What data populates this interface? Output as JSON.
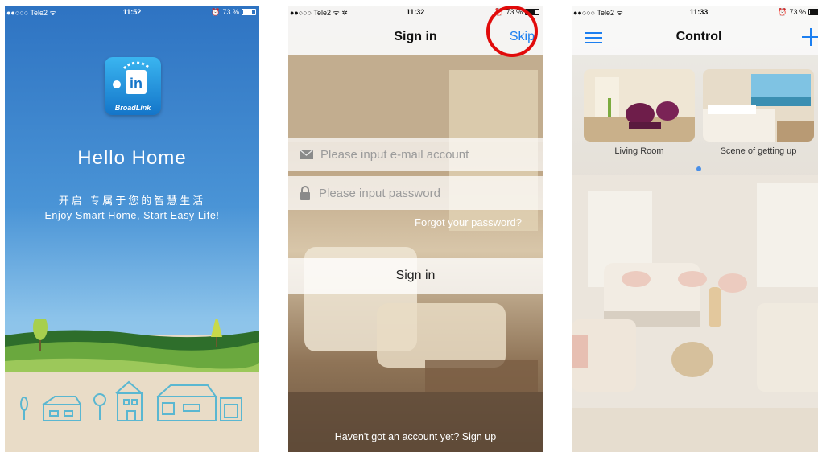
{
  "screen1": {
    "status": {
      "carrier": "●●○○○ Tele2 ᯤ",
      "time": "11:52",
      "battery": "73 %"
    },
    "logo_text": "BroadLink",
    "logo_glyph": "in",
    "title": "Hello Home",
    "subtitle_cn": "开启 专属于您的智慧生活",
    "subtitle_en": "Enjoy Smart Home, Start Easy Life!"
  },
  "screen2": {
    "status": {
      "carrier": "●●○○○ Tele2 ᯤ ✲",
      "time": "11:32",
      "battery": "73 %"
    },
    "title": "Sign in",
    "skip_label": "Skip",
    "email_placeholder": "Please input e-mail account",
    "password_placeholder": "Please input password",
    "forgot_label": "Forgot your password?",
    "signin_label": "Sign in",
    "signup_label": "Haven't got an account yet? Sign up",
    "highlight_color": "#e10b0b"
  },
  "screen3": {
    "status": {
      "carrier": "●●○○○ Tele2 ᯤ",
      "time": "11:33",
      "battery": "73 %"
    },
    "title": "Control",
    "rooms": [
      {
        "label": "Living Room"
      },
      {
        "label": "Scene of getting up"
      }
    ],
    "accent_color": "#1c7ff0"
  },
  "icons": [
    "menu-icon",
    "plus-icon",
    "envelope-icon",
    "lock-icon",
    "alarm-icon",
    "battery-icon",
    "wifi-icon"
  ]
}
